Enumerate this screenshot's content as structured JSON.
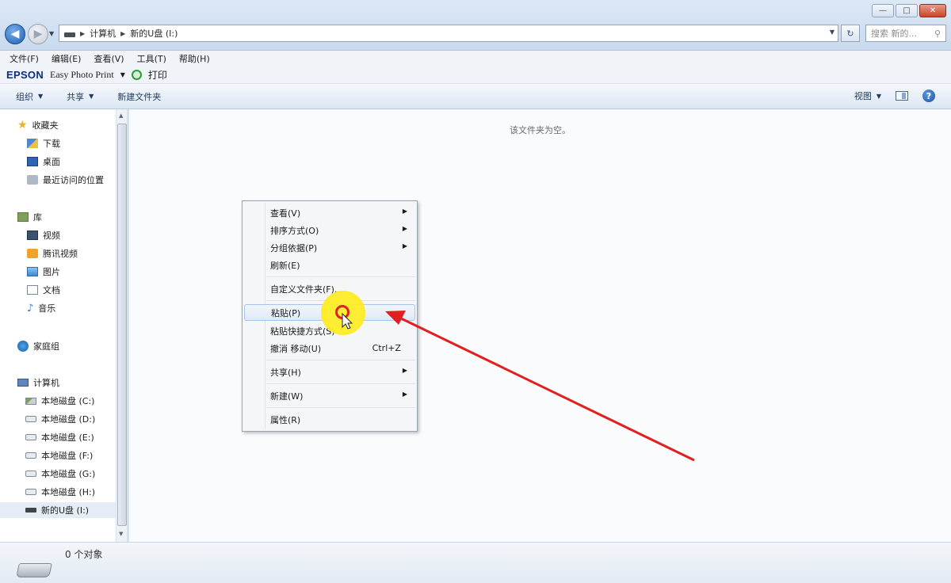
{
  "window": {
    "buttons": {
      "minimize": "—",
      "maximize": "□",
      "close": "✕"
    }
  },
  "address": {
    "segments": [
      "计算机",
      "新的U盘 (I:)"
    ],
    "search_placeholder": "搜索 新的...",
    "refresh": "↻"
  },
  "menubar": [
    "文件(F)",
    "编辑(E)",
    "查看(V)",
    "工具(T)",
    "帮助(H)"
  ],
  "epson": {
    "logo": "EPSON",
    "app": "Easy Photo Print",
    "print_label": "打印"
  },
  "commandbar": {
    "organize": "组织",
    "share": "共享",
    "new_folder": "新建文件夹",
    "view": "视图"
  },
  "navpane": {
    "favorites": {
      "label": "收藏夹",
      "items": [
        "下载",
        "桌面",
        "最近访问的位置"
      ]
    },
    "libraries": {
      "label": "库",
      "items": [
        "视频",
        "腾讯视频",
        "图片",
        "文档",
        "音乐"
      ]
    },
    "homegroup": {
      "label": "家庭组"
    },
    "computer": {
      "label": "计算机",
      "items": [
        "本地磁盘 (C:)",
        "本地磁盘 (D:)",
        "本地磁盘 (E:)",
        "本地磁盘 (F:)",
        "本地磁盘 (G:)",
        "本地磁盘 (H:)",
        "新的U盘 (I:)"
      ]
    }
  },
  "content": {
    "empty_message": "该文件夹为空。"
  },
  "context_menu": {
    "items": [
      {
        "label": "查看(V)",
        "submenu": true
      },
      {
        "label": "排序方式(O)",
        "submenu": true
      },
      {
        "label": "分组依据(P)",
        "submenu": true
      },
      {
        "label": "刷新(E)"
      },
      {
        "label": "自定义文件夹(F)..."
      },
      {
        "label": "粘贴(P)",
        "highlighted": true
      },
      {
        "label": "粘贴快捷方式(S)"
      },
      {
        "label": "撤消 移动(U)",
        "shortcut": "Ctrl+Z"
      },
      {
        "label": "共享(H)",
        "submenu": true
      },
      {
        "label": "新建(W)",
        "submenu": true
      },
      {
        "label": "属性(R)"
      }
    ]
  },
  "status": {
    "count": "0 个对象"
  },
  "colors": {
    "annotation_red": "#e21f1f",
    "cursor_highlight": "#ffe628",
    "epson_blue": "#0b2e82"
  }
}
